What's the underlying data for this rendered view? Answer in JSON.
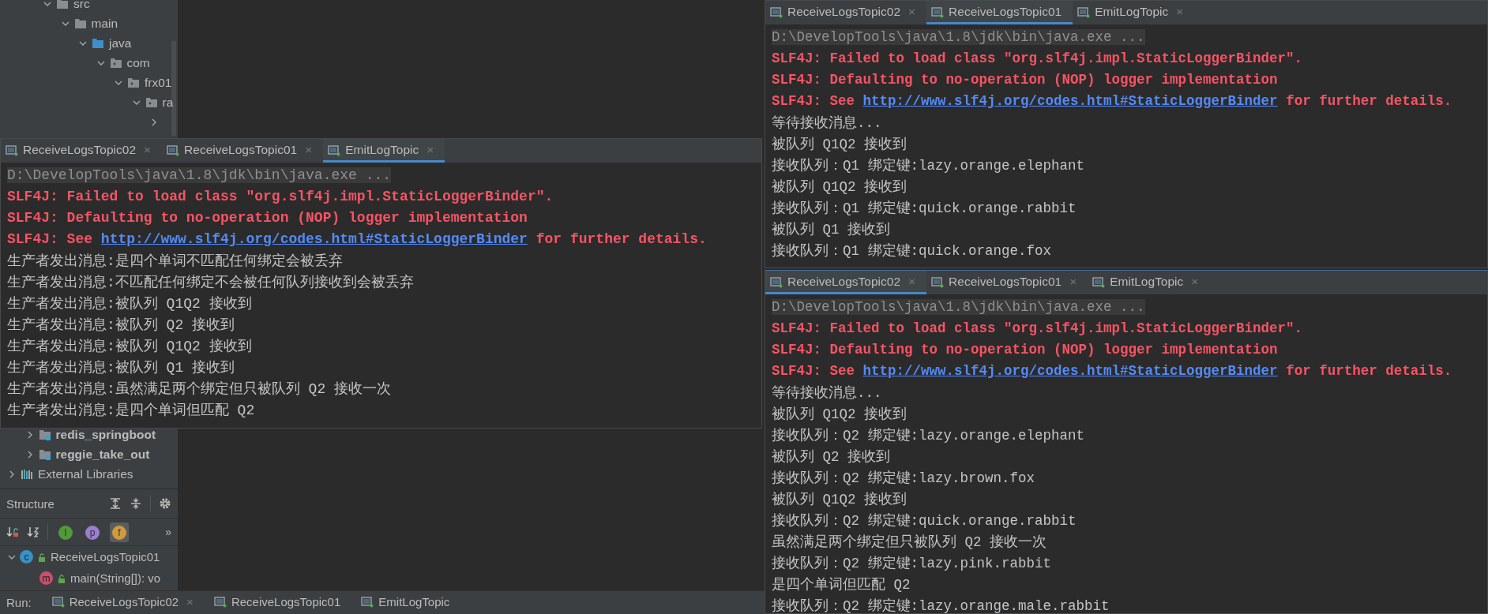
{
  "project_tree": {
    "upper": [
      {
        "label": "src",
        "kind": "folder",
        "expanded": true,
        "children": [
          {
            "label": "main",
            "kind": "folder",
            "expanded": true,
            "children": [
              {
                "label": "java",
                "kind": "source",
                "expanded": true,
                "children": [
                  {
                    "label": "com",
                    "kind": "package",
                    "expanded": true,
                    "children": [
                      {
                        "label": "frx01",
                        "kind": "package",
                        "expanded": true,
                        "children": [
                          {
                            "label": "ra",
                            "kind": "package",
                            "expanded": true,
                            "children": [
                              {
                                "expanded": false
                              }
                            ]
                          }
                        ]
                      }
                    ]
                  }
                ]
              }
            ]
          }
        ]
      }
    ],
    "lower": [
      {
        "label": "redis_springboot",
        "kind": "module",
        "expanded": false
      },
      {
        "label": "reggie_take_out",
        "kind": "module",
        "expanded": false
      },
      {
        "label": "External Libraries",
        "kind": "library",
        "expanded": false
      }
    ]
  },
  "structure": {
    "title": "Structure",
    "filters": [
      {
        "label": "I",
        "color": "#4f9a3a",
        "selected": false
      },
      {
        "label": "p",
        "color": "#9a7ed0",
        "selected": false
      },
      {
        "label": "f",
        "color": "#d19a3c",
        "selected": true
      }
    ],
    "more": "»",
    "items": [
      {
        "label": "ReceiveLogsTopic01",
        "letter": "c",
        "color": "#3592c4",
        "expanded": true,
        "children": [
          {
            "label": "main(String[]): vo",
            "letter": "m",
            "color": "#c94f6d"
          }
        ]
      }
    ]
  },
  "run_bar": {
    "label": "Run:",
    "tabs": [
      {
        "label": "ReceiveLogsTopic02",
        "close": "×",
        "selected": false
      },
      {
        "label": "ReceiveLogsTopic01",
        "selected": false
      },
      {
        "label": "EmitLogTopic",
        "selected": false
      }
    ]
  },
  "consoles": [
    {
      "tabs": [
        {
          "label": "ReceiveLogsTopic02",
          "close": "×",
          "selected": false
        },
        {
          "label": "ReceiveLogsTopic01",
          "close": "×",
          "selected": false
        },
        {
          "label": "EmitLogTopic",
          "close": "×",
          "selected": true
        }
      ],
      "lines": [
        {
          "kind": "command",
          "text": "D:\\DevelopTools\\java\\1.8\\jdk\\bin\\java.exe ..."
        },
        {
          "kind": "error",
          "text": "SLF4J: Failed to load class \"org.slf4j.impl.StaticLoggerBinder\"."
        },
        {
          "kind": "error",
          "text": "SLF4J: Defaulting to no-operation (NOP) logger implementation"
        },
        {
          "kind": "error_link",
          "text": "SLF4J: See ",
          "link": "http://www.slf4j.org/codes.html#StaticLoggerBinder",
          "after": " for further details."
        },
        {
          "kind": "output",
          "text": "生产者发出消息:是四个单词不匹配任何绑定会被丢弃"
        },
        {
          "kind": "output",
          "text": "生产者发出消息:不匹配任何绑定不会被任何队列接收到会被丢弃"
        },
        {
          "kind": "output",
          "text": "生产者发出消息:被队列 Q1Q2 接收到"
        },
        {
          "kind": "output",
          "text": "生产者发出消息:被队列 Q2 接收到"
        },
        {
          "kind": "output",
          "text": "生产者发出消息:被队列 Q1Q2 接收到"
        },
        {
          "kind": "output",
          "text": "生产者发出消息:被队列 Q1 接收到"
        },
        {
          "kind": "output",
          "text": "生产者发出消息:虽然满足两个绑定但只被队列 Q2 接收一次"
        },
        {
          "kind": "output",
          "text": "生产者发出消息:是四个单词但匹配 Q2"
        }
      ]
    },
    {
      "tabs": [
        {
          "label": "ReceiveLogsTopic02",
          "close": "×",
          "selected": false
        },
        {
          "label": "ReceiveLogsTopic01",
          "selected": true
        },
        {
          "label": "EmitLogTopic",
          "close": "×",
          "selected": false
        }
      ],
      "lines": [
        {
          "kind": "command",
          "text": "D:\\DevelopTools\\java\\1.8\\jdk\\bin\\java.exe ..."
        },
        {
          "kind": "error",
          "text": "SLF4J: Failed to load class \"org.slf4j.impl.StaticLoggerBinder\"."
        },
        {
          "kind": "error",
          "text": "SLF4J: Defaulting to no-operation (NOP) logger implementation"
        },
        {
          "kind": "error_link",
          "text": "SLF4J: See ",
          "link": "http://www.slf4j.org/codes.html#StaticLoggerBinder",
          "after": " for further details."
        },
        {
          "kind": "output",
          "text": "等待接收消息..."
        },
        {
          "kind": "output",
          "text": "被队列 Q1Q2 接收到"
        },
        {
          "kind": "output",
          "text": "接收队列：Q1  绑定键:lazy.orange.elephant"
        },
        {
          "kind": "output",
          "text": "被队列 Q1Q2 接收到"
        },
        {
          "kind": "output",
          "text": "接收队列：Q1  绑定键:quick.orange.rabbit"
        },
        {
          "kind": "output",
          "text": "被队列 Q1 接收到"
        },
        {
          "kind": "output",
          "text": "接收队列：Q1  绑定键:quick.orange.fox"
        }
      ]
    },
    {
      "tabs": [
        {
          "label": "ReceiveLogsTopic02",
          "close": "×",
          "selected": true
        },
        {
          "label": "ReceiveLogsTopic01",
          "close": "×",
          "selected": false
        },
        {
          "label": "EmitLogTopic",
          "close": "×",
          "selected": false
        }
      ],
      "lines": [
        {
          "kind": "command",
          "text": "D:\\DevelopTools\\java\\1.8\\jdk\\bin\\java.exe ..."
        },
        {
          "kind": "error",
          "text": "SLF4J: Failed to load class \"org.slf4j.impl.StaticLoggerBinder\"."
        },
        {
          "kind": "error",
          "text": "SLF4J: Defaulting to no-operation (NOP) logger implementation"
        },
        {
          "kind": "error_link",
          "text": "SLF4J: See ",
          "link": "http://www.slf4j.org/codes.html#StaticLoggerBinder",
          "after": " for further details."
        },
        {
          "kind": "output",
          "text": "等待接收消息..."
        },
        {
          "kind": "output",
          "text": "被队列 Q1Q2 接收到"
        },
        {
          "kind": "output",
          "text": "接收队列：Q2  绑定键:lazy.orange.elephant"
        },
        {
          "kind": "output",
          "text": "被队列 Q2 接收到"
        },
        {
          "kind": "output",
          "text": "接收队列：Q2  绑定键:lazy.brown.fox"
        },
        {
          "kind": "output",
          "text": "被队列 Q1Q2 接收到"
        },
        {
          "kind": "output",
          "text": "接收队列：Q2  绑定键:quick.orange.rabbit"
        },
        {
          "kind": "output",
          "text": "虽然满足两个绑定但只被队列 Q2 接收一次"
        },
        {
          "kind": "output",
          "text": "接收队列：Q2  绑定键:lazy.pink.rabbit"
        },
        {
          "kind": "output",
          "text": "是四个单词但匹配 Q2"
        },
        {
          "kind": "output",
          "text": "接收队列：Q2  绑定键:lazy.orange.male.rabbit"
        }
      ]
    }
  ]
}
